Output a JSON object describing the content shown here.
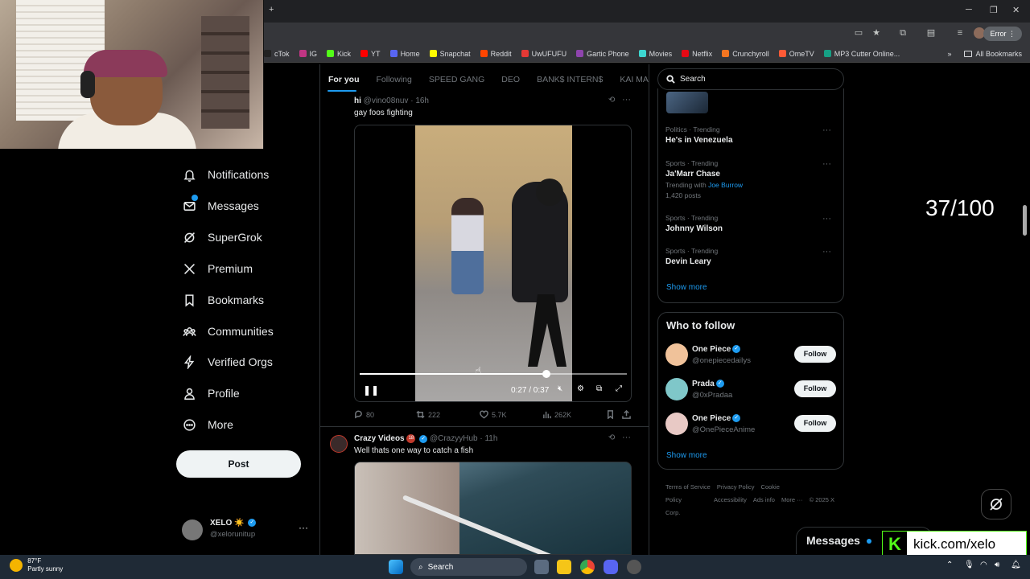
{
  "browser": {
    "error_label": "Error",
    "bookmarks": [
      {
        "label": "cTok",
        "color": "#222222"
      },
      {
        "label": "IG",
        "color": "#c13584"
      },
      {
        "label": "Kick",
        "color": "#53fc18"
      },
      {
        "label": "YT",
        "color": "#ff0000"
      },
      {
        "label": "Home",
        "color": "#5865f2"
      },
      {
        "label": "Snapchat",
        "color": "#fffc00"
      },
      {
        "label": "Reddit",
        "color": "#ff4500"
      },
      {
        "label": "UwUFUFU",
        "color": "#e53935"
      },
      {
        "label": "Gartic Phone",
        "color": "#8e44ad"
      },
      {
        "label": "Movies",
        "color": "#3dd6d0"
      },
      {
        "label": "Netflix",
        "color": "#e50914"
      },
      {
        "label": "Crunchyroll",
        "color": "#f47521"
      },
      {
        "label": "OmeTV",
        "color": "#ff5a36"
      },
      {
        "label": "MP3 Cutter Online...",
        "color": "#16a085"
      }
    ],
    "all_bookmarks": "All Bookmarks"
  },
  "nav": {
    "items": [
      {
        "label": "Notifications",
        "icon": "bell-icon"
      },
      {
        "label": "Messages",
        "icon": "envelope-icon"
      },
      {
        "label": "SuperGrok",
        "icon": "grok-icon"
      },
      {
        "label": "Premium",
        "icon": "x-logo-icon"
      },
      {
        "label": "Bookmarks",
        "icon": "bookmark-icon"
      },
      {
        "label": "Communities",
        "icon": "communities-icon"
      },
      {
        "label": "Verified Orgs",
        "icon": "lightning-icon"
      },
      {
        "label": "Profile",
        "icon": "person-icon"
      },
      {
        "label": "More",
        "icon": "more-circle-icon"
      }
    ],
    "post_label": "Post",
    "account": {
      "name": "XELO",
      "emoji": "☀️",
      "handle": "@xelorunitup"
    }
  },
  "feed": {
    "tabs": [
      "For you",
      "Following",
      "SPEED GANG",
      "DEO",
      "BANK$ INTERN$",
      "KAI MA"
    ],
    "tweet1": {
      "name": "hi",
      "handle": "@vino08nuv",
      "time": "16h",
      "text": "gay foos fighting",
      "video_time": "0:27 / 0:37",
      "progress": 0.7,
      "stats": {
        "replies": "80",
        "reposts": "222",
        "likes": "5.7K",
        "views": "262K"
      }
    },
    "tweet2": {
      "name": "Crazy Videos",
      "badge": "18",
      "handle": "@CrazyyHub",
      "time": "11h",
      "text": "Well thats one way to catch a fish"
    }
  },
  "sidebar": {
    "search_placeholder": "Search",
    "trends": [
      {
        "category": "Politics · Trending",
        "name": "He's in Venezuela"
      },
      {
        "category": "Sports · Trending",
        "name": "Ja'Marr Chase",
        "extra_prefix": "Trending with",
        "extra_link": "Joe Burrow",
        "posts": "1,420 posts"
      },
      {
        "category": "Sports · Trending",
        "name": "Johnny Wilson"
      },
      {
        "category": "Sports · Trending",
        "name": "Devin Leary"
      }
    ],
    "show_more": "Show more",
    "who_to_follow_title": "Who to follow",
    "follow_suggestions": [
      {
        "name": "One Piece",
        "handle": "@onepiecedaiIys",
        "color": "#f0c29a"
      },
      {
        "name": "Prada",
        "handle": "@0xPradaa",
        "color": "#7fc7c9"
      },
      {
        "name": "One Piece",
        "handle": "@OnePieceAnime",
        "color": "#e8c9c5"
      }
    ],
    "follow_label": "Follow",
    "footer": [
      "Terms of Service",
      "Privacy Policy",
      "Cookie Policy",
      "Accessibility",
      "Ads info",
      "More ···",
      "© 2025 X Corp."
    ]
  },
  "overlay": {
    "counter": "37/100",
    "messages_label": "Messages",
    "kick_url": "kick.com/xelo"
  },
  "taskbar": {
    "temp": "87°F",
    "weather": "Partly sunny",
    "search_label": "Search"
  }
}
